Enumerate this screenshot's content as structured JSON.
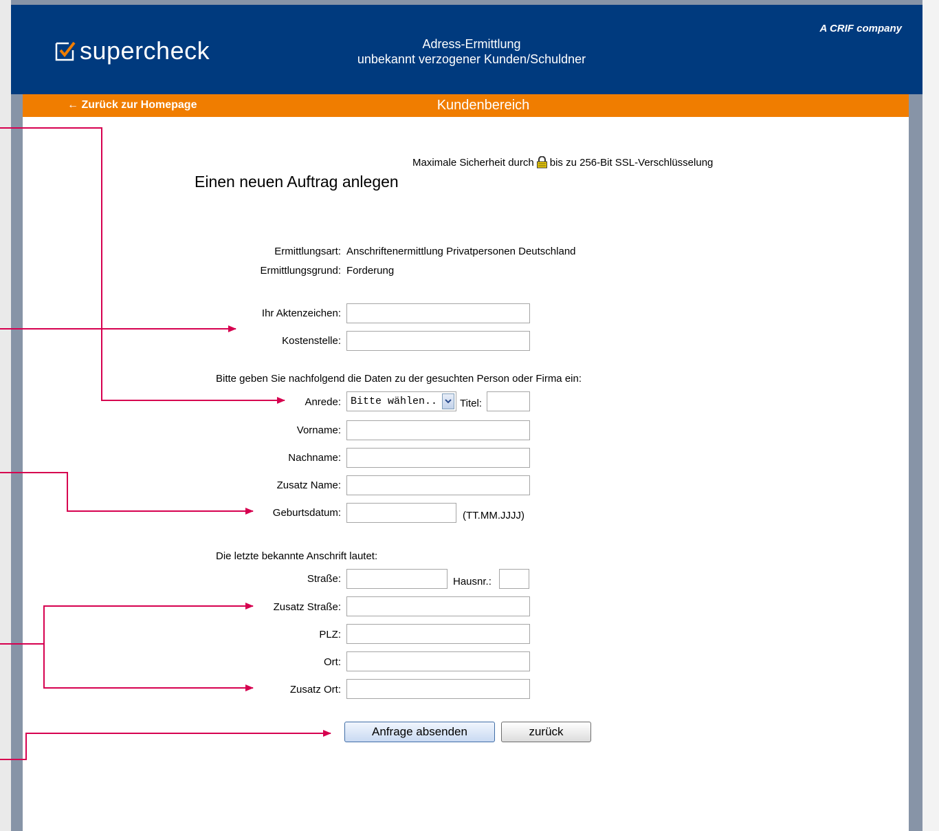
{
  "header": {
    "logo_text": "supercheck",
    "crif": "A CRIF company",
    "title_line1": "Adress-Ermittlung",
    "title_line2": "unbekannt verzogener Kunden/Schuldner"
  },
  "nav": {
    "back_link": "← Zurück zur Homepage",
    "area_title": "Kundenbereich"
  },
  "ssl": {
    "before": "Maximale Sicherheit durch",
    "after": "bis zu 256-Bit SSL-Verschlüsselung"
  },
  "page_title": "Einen neuen Auftrag anlegen",
  "info": {
    "ermittlungsart_label": "Ermittlungsart:",
    "ermittlungsart_value": "Anschriftenermittlung Privatpersonen Deutschland",
    "ermittlungsgrund_label": "Ermittlungsgrund:",
    "ermittlungsgrund_value": "Forderung"
  },
  "form": {
    "aktenzeichen_label": "Ihr Aktenzeichen:",
    "kostenstelle_label": "Kostenstelle:",
    "person_intro": "Bitte geben Sie nachfolgend die Daten zu der gesuchten Person oder Firma ein:",
    "anrede_label": "Anrede:",
    "anrede_value": "Bitte wählen..",
    "titel_label": "Titel:",
    "vorname_label": "Vorname:",
    "nachname_label": "Nachname:",
    "zusatz_name_label": "Zusatz Name:",
    "geburtsdatum_label": "Geburtsdatum:",
    "geburtsdatum_hint": "(TT.MM.JJJJ)",
    "address_intro": "Die letzte bekannte Anschrift lautet:",
    "strasse_label": "Straße:",
    "hausnr_label": "Hausnr.:",
    "zusatz_strasse_label": "Zusatz Straße:",
    "plz_label": "PLZ:",
    "ort_label": "Ort:",
    "zusatz_ort_label": "Zusatz Ort:"
  },
  "buttons": {
    "submit": "Anfrage absenden",
    "back": "zurück"
  },
  "colors": {
    "header_blue": "#003a7e",
    "nav_orange": "#f07d00",
    "annotation_red": "#d6004f"
  }
}
